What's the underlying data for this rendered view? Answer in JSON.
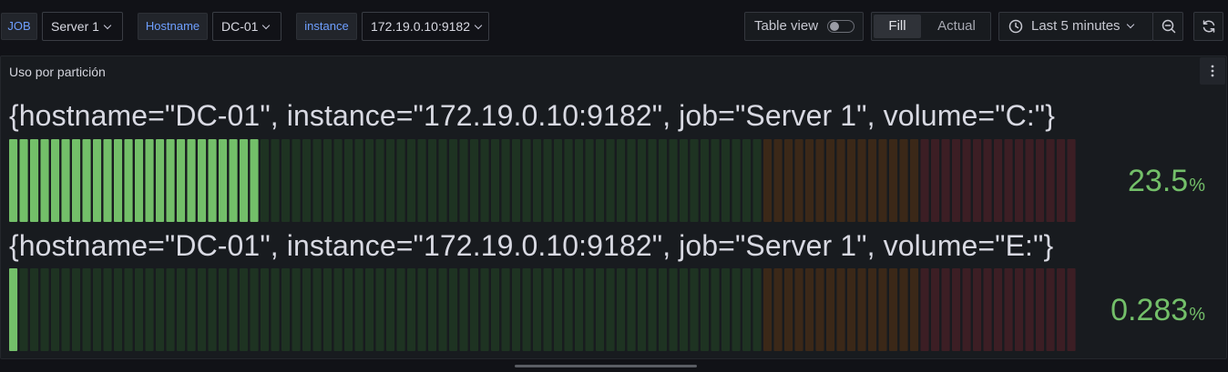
{
  "variables": [
    {
      "label": "JOB",
      "value": "Server 1"
    },
    {
      "label": "Hostname",
      "value": "DC-01"
    },
    {
      "label": "instance",
      "value": "172.19.0.10:9182"
    }
  ],
  "controls": {
    "table_view_label": "Table view",
    "table_view_on": false,
    "fill_label": "Fill",
    "actual_label": "Actual",
    "time_range": "Last 5 minutes",
    "icons": [
      "clock-icon",
      "chevron-down-icon",
      "zoom-out-icon",
      "refresh-icon",
      "kebab-menu-icon"
    ]
  },
  "panel": {
    "title": "Uso por partición",
    "gauges": [
      {
        "name": "{hostname=\"DC-01\", instance=\"172.19.0.10:9182\", job=\"Server 1\", volume=\"C:\"}",
        "value_text": "23.5",
        "unit": "%",
        "value": 23.5
      },
      {
        "name": "{hostname=\"DC-01\", instance=\"172.19.0.10:9182\", job=\"Server 1\", volume=\"E:\"}",
        "value_text": "0.283",
        "unit": "%",
        "value": 0.283
      }
    ],
    "thresholds": [
      {
        "from": 0,
        "color": "#73bf69"
      },
      {
        "from": 70,
        "color": "#ff9830"
      },
      {
        "from": 85,
        "color": "#f2495c"
      }
    ],
    "max": 100
  }
}
